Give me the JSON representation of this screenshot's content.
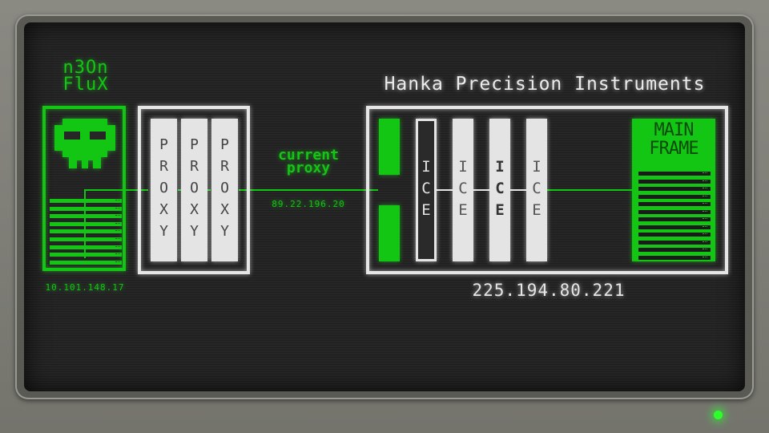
{
  "player": {
    "name": "n3On\nFluX",
    "ip": "10.101.148.17"
  },
  "proxies": [
    {
      "label": "PROXY"
    },
    {
      "label": "PROXY"
    },
    {
      "label": "PROXY"
    }
  ],
  "current_proxy": {
    "label": "current\nproxy",
    "ip": "89.22.196.20"
  },
  "target": {
    "name": "Hanka Precision Instruments",
    "ip": "225.194.80.221",
    "ice": [
      {
        "label": "ICE",
        "state": "selected"
      },
      {
        "label": "ICE",
        "state": "light"
      },
      {
        "label": "ICE",
        "state": "dark"
      },
      {
        "label": "ICE",
        "state": "light"
      }
    ],
    "mainframe_label": "MAIN\nFRAME"
  },
  "colors": {
    "accent_green": "#13c613",
    "frame_white": "#e6e6e6",
    "screen_bg": "#262626",
    "power_led": "#2cff2c"
  },
  "icons": {
    "player_avatar": "skull-icon",
    "power_indicator": "power-led-icon"
  }
}
